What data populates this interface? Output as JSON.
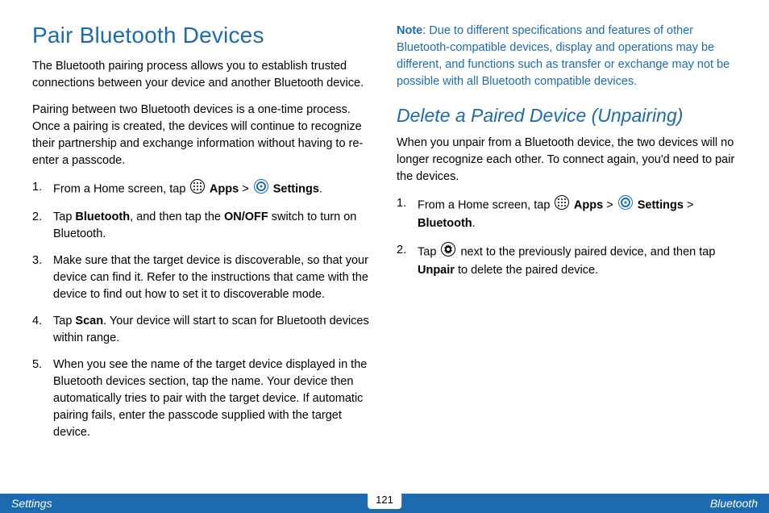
{
  "left": {
    "heading": "Pair Bluetooth Devices",
    "p1": "The Bluetooth pairing process allows you to establish trusted connections between your device and another Bluetooth device.",
    "p2": "Pairing between two Bluetooth devices is a one-time process. Once a pairing is created, the devices will continue to recognize their partnership and exchange information without having to re-enter a passcode.",
    "steps": {
      "s1a": "From a Home screen, tap ",
      "s1b": " Apps",
      "s1c": " > ",
      "s1d": " Settings",
      "s1e": ".",
      "s2a": "Tap ",
      "s2b": "Bluetooth",
      "s2c": ", and then tap the ",
      "s2d": "ON/OFF",
      "s2e": " switch to turn on Bluetooth.",
      "s3": "Make sure that the target device is discoverable, so that your device can find it. Refer to the instructions that came with the device to find out how to set it to discoverable mode.",
      "s4a": "Tap ",
      "s4b": "Scan",
      "s4c": ". Your device will start to scan for Bluetooth devices within range.",
      "s5": "When you see the name of the target device displayed in the Bluetooth devices section, tap the name. Your device then automatically tries to pair with the target device. If automatic pairing fails, enter the passcode supplied with the target device."
    }
  },
  "right": {
    "noteLabel": "Note",
    "noteText": ": Due to different specifications and features of other Bluetooth-compatible devices, display and operations may be different, and functions such as transfer or exchange may not be possible with all Bluetooth compatible devices.",
    "heading": "Delete a Paired Device (Unpairing)",
    "p1": "When you unpair from a Bluetooth device, the two devices will no longer recognize each other. To connect again, you'd need to pair the devices.",
    "steps": {
      "s1a": "From a Home screen, tap ",
      "s1b": " Apps",
      "s1c": " > ",
      "s1d": " Settings",
      "s1e": " > ",
      "s1f": "Bluetooth",
      "s1g": ".",
      "s2a": "Tap ",
      "s2b": " next to the previously paired device, and then tap ",
      "s2c": "Unpair",
      "s2d": " to delete the paired device."
    }
  },
  "footer": {
    "left": "Settings",
    "center": "121",
    "right": "Bluetooth"
  }
}
